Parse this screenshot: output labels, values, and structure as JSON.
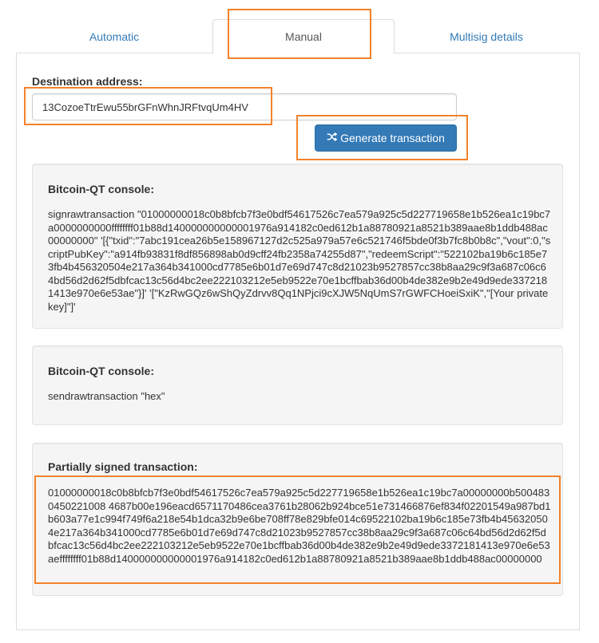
{
  "tabs": {
    "automatic": "Automatic",
    "manual": "Manual",
    "multisig": "Multisig details"
  },
  "form": {
    "destination_label": "Destination address:",
    "destination_value": "13CozoeTtrEwu55brGFnWhnJRFtvqUm4HV",
    "generate_button": "Generate transaction"
  },
  "console1": {
    "title": "Bitcoin-QT console:",
    "command": "signrawtransaction \"01000000018c0b8bfcb7f3e0bdf54617526c7ea579a925c5d227719658e1b526ea1c19bc7a0000000000ffffffff01b88d140000000000001976a914182c0ed612b1a88780921a8521b389aae8b1ddb488ac00000000\" '[{\"txid\":\"7abc191cea26b5e158967127d2c525a979a57e6c521746f5bde0f3b7fc8b0b8c\",\"vout\":0,\"scriptPubKey\":\"a914fb93831f8df856898ab0d9cff24fb2358a74255d87\",\"redeemScript\":\"522102ba19b6c185e73fb4b456320504e217a364b341000cd7785e6b01d7e69d747c8d21023b9527857cc38b8aa29c9f3a687c06c64bd56d2d62f5dbfcac13c56d4bc2ee222103212e5eb9522e70e1bcffbab36d00b4de382e9b2e49d9ede3372181413e970e6e53ae\"}]' '[\"KzRwGQz6wShQyZdrvv8Qq1NPjci9cXJW5NqUmS7rGWFCHoeiSxiK\",\"[Your private key]\"]'"
  },
  "console2": {
    "title": "Bitcoin-QT console:",
    "command": "sendrawtransaction \"hex\""
  },
  "partial": {
    "title": "Partially signed transaction:",
    "hex": "01000000018c0b8bfcb7f3e0bdf54617526c7ea579a925c5d227719658e1b526ea1c19bc7a00000000b5004830450221008 4687b00e196eacd6571170486cea3761b28062b924bce51e731466876ef834f02201549a987bd1b603a77e1c994f749f6a218e54b1dca32b9e6be708ff78e829bfe014c69522102ba19b6c185e73fb4b456320504e217a364b341000cd7785e6b01d7e69d747c8d21023b9527857cc38b8aa29c9f3a687c06c64bd56d2d62f5dbfcac13c56d4bc2ee222103212e5eb9522e70e1bcffbab36d00b4de382e9b2e49d9ede3372181413e970e6e53aeffffffff01b88d140000000000001976a914182c0ed612b1a88780921a8521b389aae8b1ddb488ac00000000"
  },
  "colors": {
    "highlight": "#f4822a",
    "link": "#337ab7",
    "button": "#337ab7"
  },
  "icons": {
    "generate": "random-shuffle-icon"
  }
}
